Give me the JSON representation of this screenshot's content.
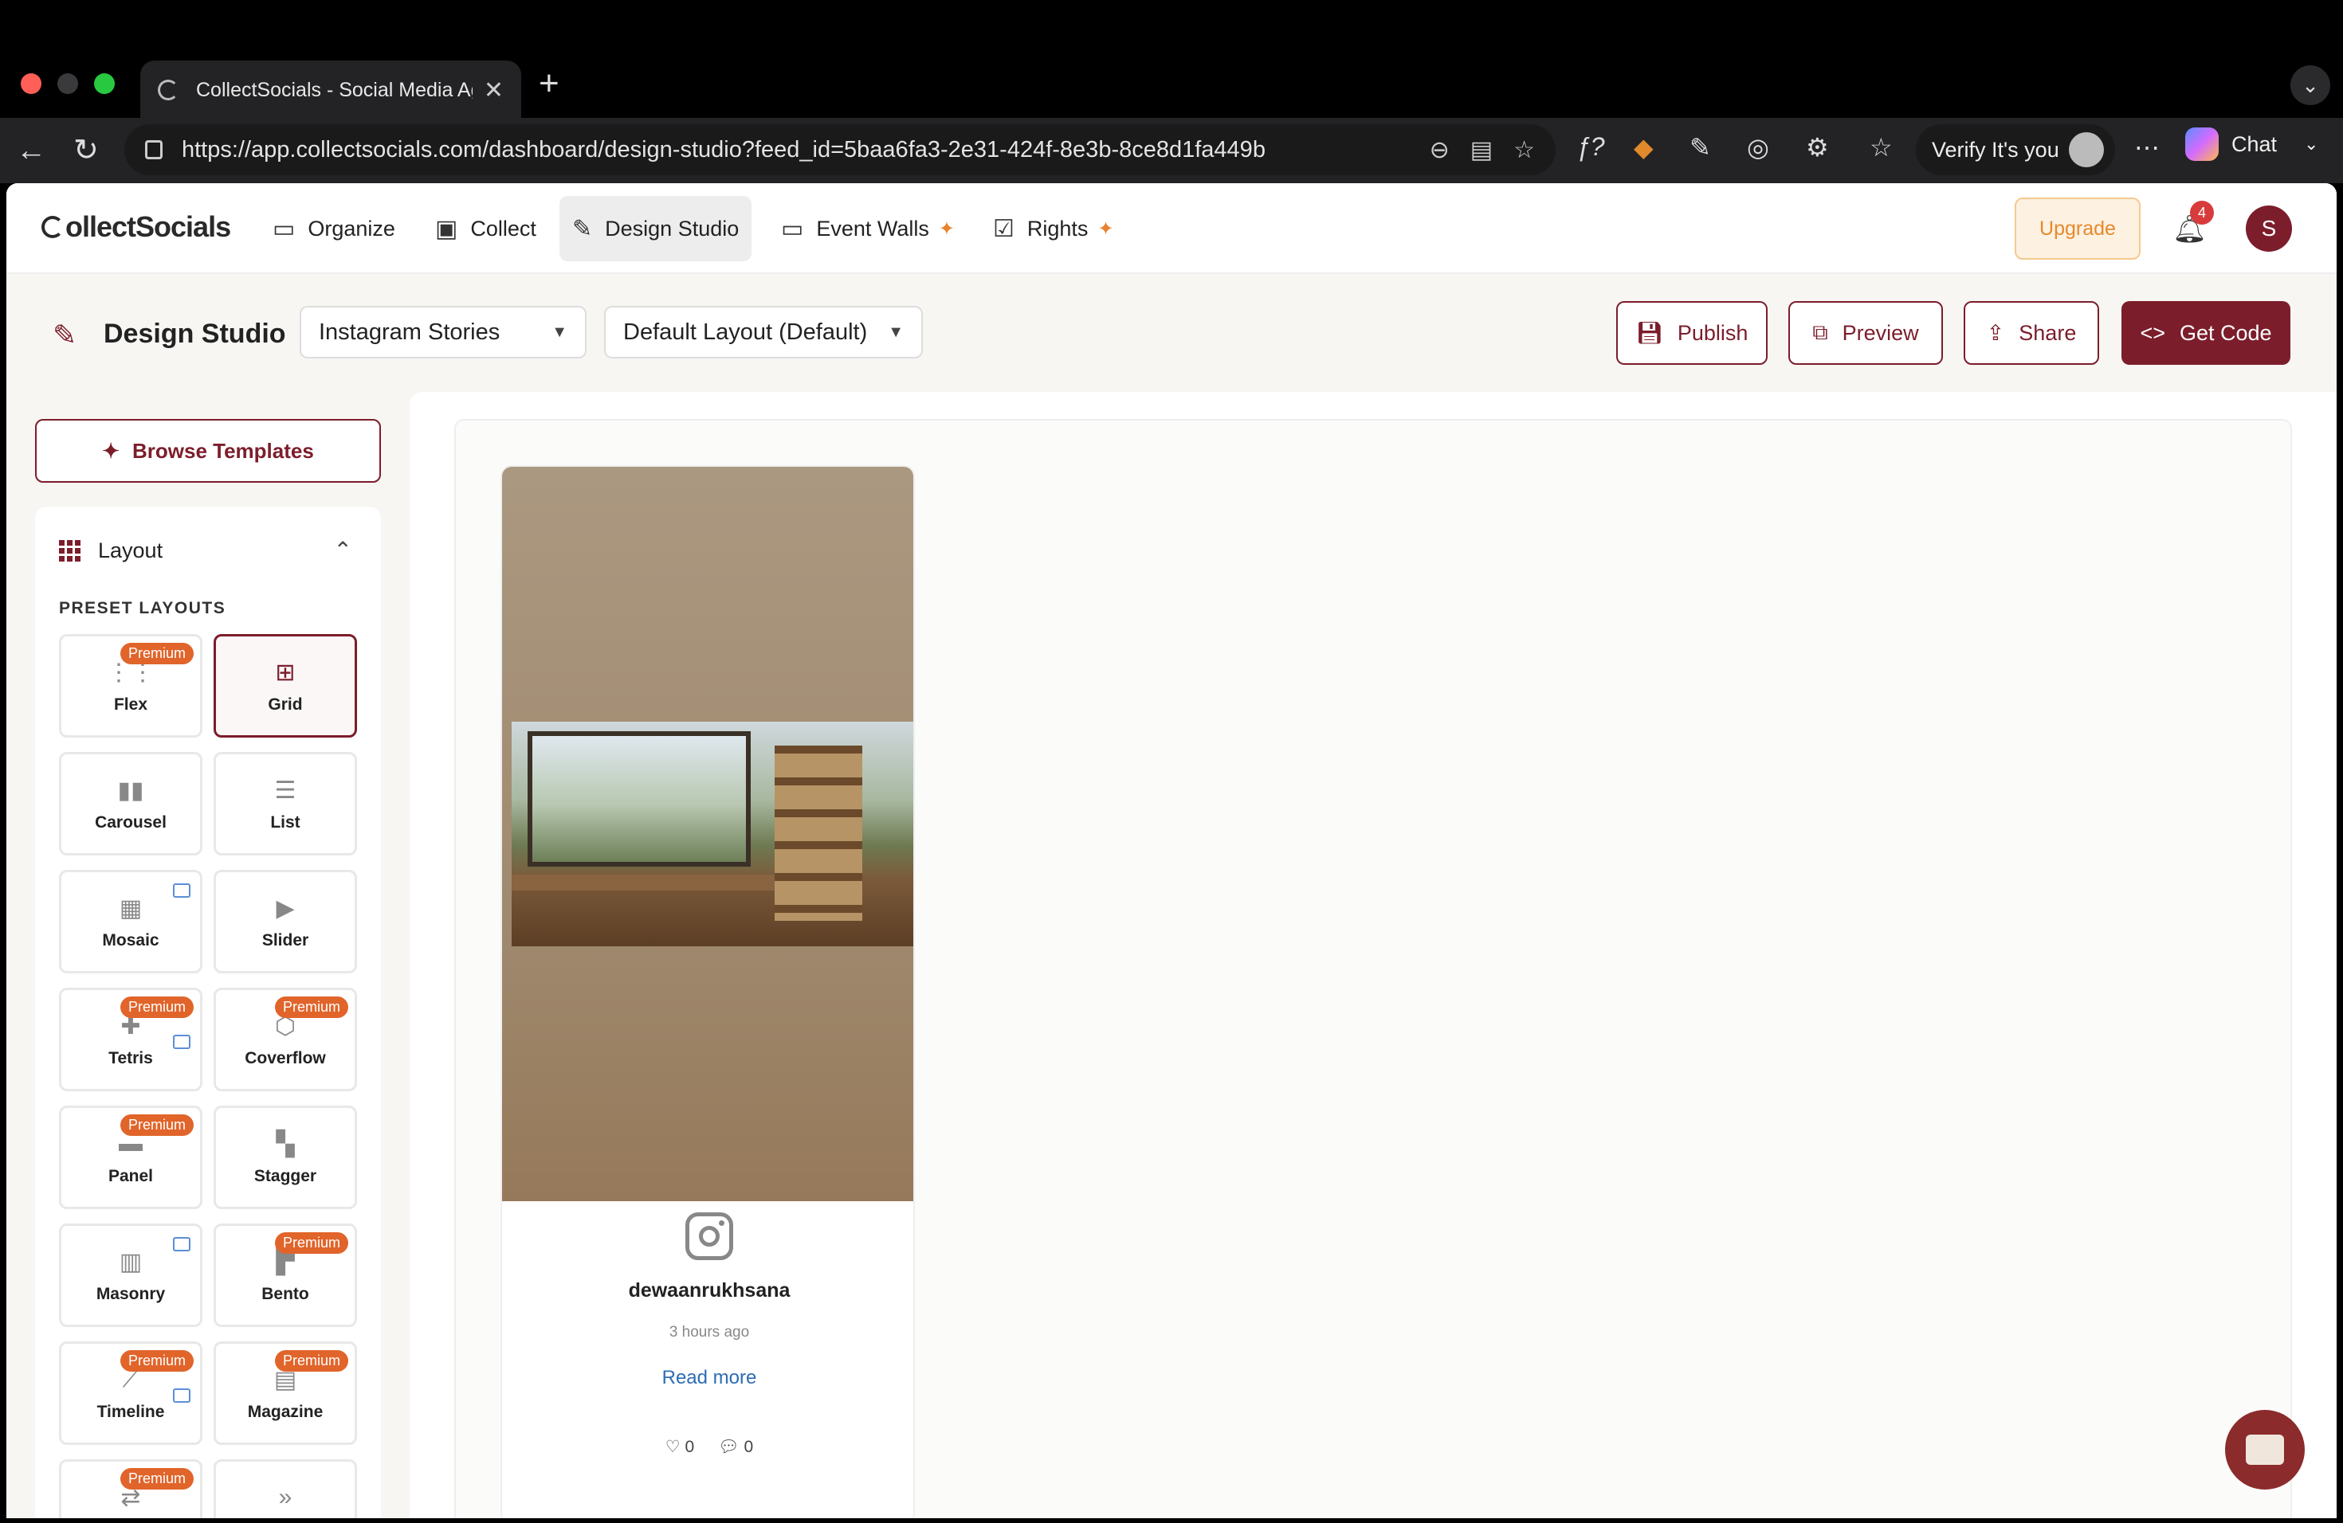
{
  "browser": {
    "tab_title": "CollectSocials - Social Media Ag",
    "url": "https://app.collectsocials.com/dashboard/design-studio?feed_id=5baa6fa3-2e31-424f-8e3b-8ce8d1fa449b",
    "verify_label": "Verify It's you",
    "chat_label": "Chat",
    "traffic_colors": [
      "#ff5f57",
      "#3a3a3c",
      "#28c840"
    ]
  },
  "header": {
    "brand": "ollectSocials",
    "nav": [
      {
        "label": "Organize",
        "icon": "folder-icon"
      },
      {
        "label": "Collect",
        "icon": "image-icon"
      },
      {
        "label": "Design Studio",
        "icon": "brush-icon",
        "active": true
      },
      {
        "label": "Event Walls",
        "icon": "monitor-icon",
        "sparkle": true
      },
      {
        "label": "Rights",
        "icon": "checklist-icon",
        "sparkle": true
      }
    ],
    "upgrade_label": "Upgrade",
    "notification_count": "4",
    "avatar_initial": "S"
  },
  "studio": {
    "title": "Design Studio",
    "feed_select": "Instagram Stories",
    "layout_select": "Default Layout (Default)",
    "actions": {
      "publish": "Publish",
      "preview": "Preview",
      "share": "Share",
      "get_code": "Get Code"
    },
    "accent_color": "#7c1d2b"
  },
  "sidebar": {
    "browse_templates": "Browse Templates",
    "section_title": "Layout",
    "preset_heading": "PRESET LAYOUTS",
    "premium_label": "Premium",
    "layouts": [
      {
        "label": "Flex",
        "premium": true,
        "icon": "flex-grid-icon"
      },
      {
        "label": "Grid",
        "selected": true,
        "icon": "grid-icon"
      },
      {
        "label": "Carousel",
        "icon": "carousel-icon"
      },
      {
        "label": "List",
        "icon": "list-icon"
      },
      {
        "label": "Mosaic",
        "image": true,
        "icon": "mosaic-icon"
      },
      {
        "label": "Slider",
        "icon": "slider-icon"
      },
      {
        "label": "Tetris",
        "premium": true,
        "image": true,
        "icon": "puzzle-icon"
      },
      {
        "label": "Coverflow",
        "premium": true,
        "icon": "coverflow-icon"
      },
      {
        "label": "Panel",
        "premium": true,
        "icon": "panel-icon"
      },
      {
        "label": "Stagger",
        "icon": "stagger-icon"
      },
      {
        "label": "Masonry",
        "image": true,
        "icon": "masonry-icon"
      },
      {
        "label": "Bento",
        "premium": true,
        "icon": "bento-icon"
      },
      {
        "label": "Timeline",
        "premium": true,
        "image": true,
        "icon": "timeline-icon"
      },
      {
        "label": "Magazine",
        "premium": true,
        "icon": "magazine-icon"
      },
      {
        "label": "",
        "premium": true,
        "icon": "swap-icon"
      },
      {
        "label": "",
        "icon": "double-chevron-icon"
      }
    ]
  },
  "post": {
    "platform_icon": "instagram-icon",
    "username": "dewaanrukhsana",
    "time_ago": "3 hours ago",
    "read_more": "Read more",
    "likes": "0",
    "comments": "0"
  }
}
